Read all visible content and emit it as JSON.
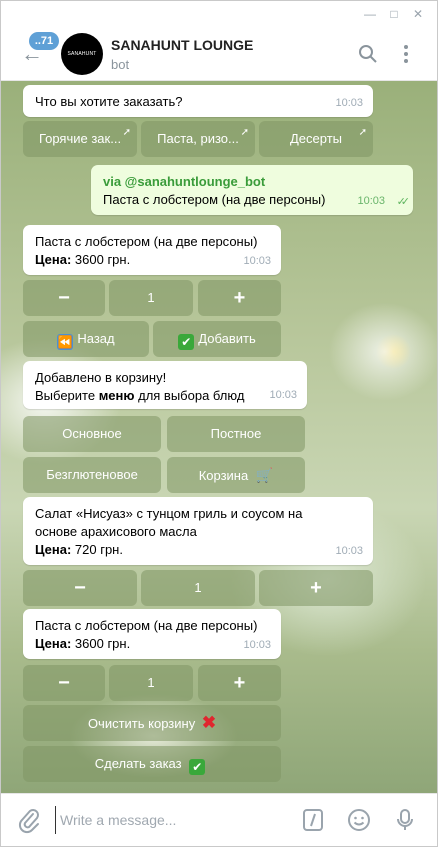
{
  "header": {
    "unread": "..71",
    "avatar_text": "SANAHUNT LOUNGE",
    "title": "SANAHUNT LOUNGE",
    "subtitle": "bot"
  },
  "messages": {
    "m1_text": "Что вы хотите заказать?",
    "m1_time": "10:03",
    "menu_row": [
      "Горячие зак...",
      "Паста, ризо...",
      "Десерты"
    ],
    "m2_via": "via @sanahuntlounge_bot",
    "m2_text": "Паста с лобстером (на две персоны)",
    "m2_time": "10:03",
    "m3_title": "Паста с лобстером (на две персоны)",
    "m3_price_label": "Цена:",
    "m3_price": " 3600 грн.",
    "m3_time": "10:03",
    "qty1": {
      "minus": "−",
      "count": "1",
      "plus": "+"
    },
    "back_label": "Назад",
    "add_label": "Добавить",
    "m4_line1": "Добавлено в корзину!",
    "m4_line2_pre": "Выберите ",
    "m4_line2_bold": "меню",
    "m4_line2_post": " для выбора блюд",
    "m4_time": "10:03",
    "cat_main": "Основное",
    "cat_lent": "Постное",
    "cat_gf": "Безглютеновое",
    "cat_cart": "Корзина",
    "m5_title": "Салат «Нисуаз» с тунцом гриль и соусом на основе арахисового масла",
    "m5_price_label": "Цена:",
    "m5_price": " 720 грн.",
    "m5_time": "10:03",
    "qty2": {
      "minus": "−",
      "count": "1",
      "plus": "+"
    },
    "m6_title": "Паста с лобстером (на две персоны)",
    "m6_price_label": "Цена:",
    "m6_price": " 3600 грн.",
    "m6_time": "10:03",
    "qty3": {
      "minus": "−",
      "count": "1",
      "plus": "+"
    },
    "clear_cart": "Очистить корзину",
    "place_order": "Сделать заказ"
  },
  "input": {
    "placeholder": "Write a message..."
  },
  "icons": {
    "back": "arrow-left-icon",
    "search": "search-icon",
    "menu": "more-vertical-icon",
    "attach": "paperclip-icon",
    "commands": "slash-command-icon",
    "emoji": "smiley-icon",
    "voice": "microphone-icon",
    "rewind": "rewind-icon",
    "check": "check-mark-icon",
    "cart": "shopping-cart-icon",
    "cross": "red-cross-icon"
  },
  "colors": {
    "accent": "#5fa0d6",
    "outgoing_bubble": "#effdde",
    "via_green": "#3a9c3a",
    "keyboard_button": "#80966480"
  }
}
